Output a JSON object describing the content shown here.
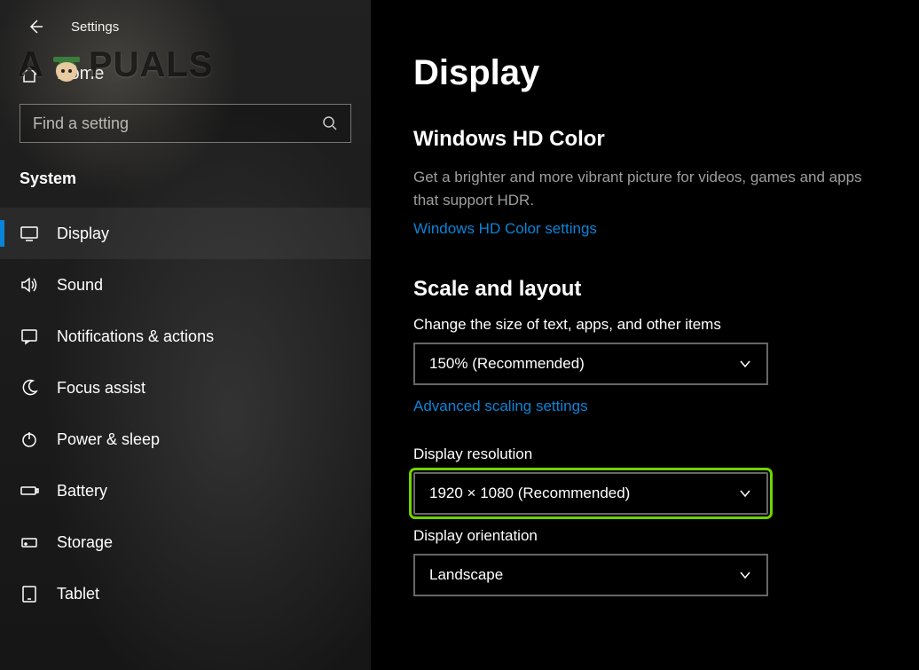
{
  "window": {
    "title": "Settings"
  },
  "watermark": {
    "prefix": "A",
    "suffix": "PUALS"
  },
  "home": {
    "label": "Home"
  },
  "search": {
    "placeholder": "Find a setting"
  },
  "category": {
    "label": "System"
  },
  "sidebar": {
    "items": [
      {
        "label": "Display",
        "icon": "monitor-icon",
        "active": true
      },
      {
        "label": "Sound",
        "icon": "speaker-icon",
        "active": false
      },
      {
        "label": "Notifications & actions",
        "icon": "notification-icon",
        "active": false
      },
      {
        "label": "Focus assist",
        "icon": "moon-icon",
        "active": false
      },
      {
        "label": "Power & sleep",
        "icon": "power-icon",
        "active": false
      },
      {
        "label": "Battery",
        "icon": "battery-icon",
        "active": false
      },
      {
        "label": "Storage",
        "icon": "storage-icon",
        "active": false
      },
      {
        "label": "Tablet",
        "icon": "tablet-icon",
        "active": false
      }
    ]
  },
  "main": {
    "page_title": "Display",
    "hd_color": {
      "title": "Windows HD Color",
      "desc": "Get a brighter and more vibrant picture for videos, games and apps that support HDR.",
      "link": "Windows HD Color settings"
    },
    "scale_layout": {
      "title": "Scale and layout",
      "text_size_label": "Change the size of text, apps, and other items",
      "text_size_value": "150% (Recommended)",
      "advanced_link": "Advanced scaling settings",
      "resolution_label": "Display resolution",
      "resolution_value": "1920 × 1080 (Recommended)",
      "orientation_label": "Display orientation",
      "orientation_value": "Landscape"
    }
  }
}
